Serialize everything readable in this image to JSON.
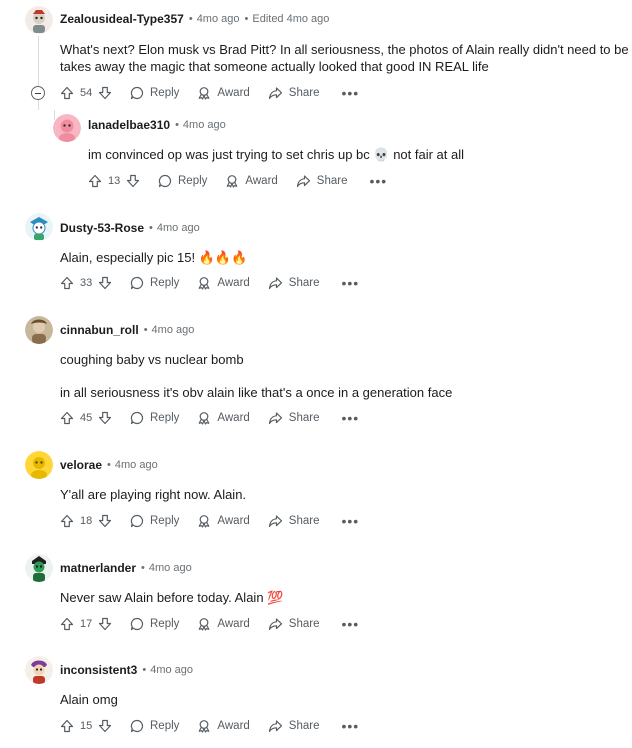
{
  "comments": [
    {
      "username": "Zealousideal-Type357",
      "time": "4mo ago",
      "edited": "Edited 4mo ago",
      "lines": [
        "What's next? Elon musk vs Brad Pitt? In all seriousness, the photos of Alain really didn't need to be yass",
        "takes away the magic that someone actually looked that good IN REAL life"
      ],
      "score": "54"
    },
    {
      "username": "lanadelbae310",
      "time": "4mo ago",
      "lines": [
        "im convinced op was just trying to set chris up bc 💀 not fair at all"
      ],
      "score": "13"
    },
    {
      "username": "Dusty-53-Rose",
      "time": "4mo ago",
      "lines": [
        "Alain, especially pic 15! 🔥🔥🔥"
      ],
      "score": "33"
    },
    {
      "username": "cinnabun_roll",
      "time": "4mo ago",
      "lines": [
        "coughing baby vs nuclear bomb",
        "in all seriousness it's obv alain like that's a once in a generation face"
      ],
      "score": "45"
    },
    {
      "username": "velorae",
      "time": "4mo ago",
      "lines": [
        "Y'all are playing right now. Alain."
      ],
      "score": "18"
    },
    {
      "username": "matnerlander",
      "time": "4mo ago",
      "lines": [
        "Never saw Alain before today. Alain 💯"
      ],
      "score": "17"
    },
    {
      "username": "inconsistent3",
      "time": "4mo ago",
      "lines": [
        "Alain omg"
      ],
      "score": "15"
    }
  ],
  "labels": {
    "reply": "Reply",
    "award": "Award",
    "share": "Share",
    "more": "•••",
    "dot": "•"
  },
  "icons": [
    "upvote-icon",
    "downvote-icon",
    "reply-icon",
    "award-icon",
    "share-icon",
    "collapse-icon"
  ],
  "colors": {
    "text": "#1c1c1c",
    "meta": "#6a7075",
    "action": "#555c62",
    "thread_line": "#d9dde0"
  }
}
